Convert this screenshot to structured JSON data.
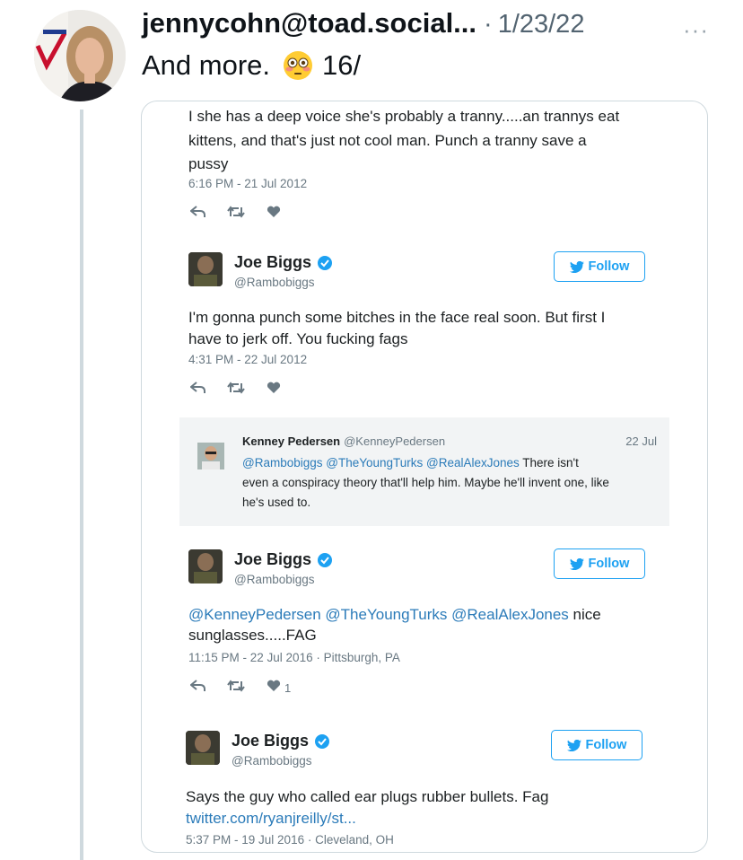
{
  "post": {
    "author": "jennycohn@toad.social...",
    "separator": "·",
    "date": "1/23/22",
    "more_label": "···",
    "text": "And more.",
    "emoji": "flushed-face-emoji",
    "suffix": "16/"
  },
  "embed": {
    "tweet1": {
      "lines": [
        "I she has a deep voice she's probably a tranny.....an trannys eat",
        "kittens, and that's just not cool man. Punch a tranny save a",
        "pussy"
      ],
      "meta": "6:16 PM - 21 Jul 2012"
    },
    "tweet2": {
      "name": "Joe Biggs",
      "handle": "@Rambobiggs",
      "follow": "Follow",
      "lines": [
        "I'm gonna punch some bitches in the face real soon. But first I",
        "have to jerk off. You fucking fags"
      ],
      "meta": "4:31 PM - 22 Jul 2012"
    },
    "quote": {
      "name": "Kenney Pedersen",
      "handle": "@KenneyPedersen",
      "date": "22 Jul",
      "mentions": "@Rambobiggs @TheYoungTurks @RealAlexJones",
      "text_after": " There isn't",
      "line2": "even a conspiracy theory that'll help him. Maybe he'll invent one, like",
      "line3": "he's used to."
    },
    "tweet3": {
      "name": "Joe Biggs",
      "handle": "@Rambobiggs",
      "follow": "Follow",
      "mentions": "@KenneyPedersen @TheYoungTurks @RealAlexJones",
      "text_after": " nice",
      "line2": "sunglasses.....FAG",
      "meta": "11:15 PM - 22 Jul 2016 · Pittsburgh, PA",
      "like_count": "1"
    },
    "tweet4": {
      "name": "Joe Biggs",
      "handle": "@Rambobiggs",
      "follow": "Follow",
      "line1": "Says the guy who called ear plugs rubber bullets. Fag",
      "link": "twitter.com/ryanjreilly/st...",
      "meta": "5:37 PM - 19 Jul 2016 · Cleveland, OH"
    }
  },
  "colors": {
    "link": "#2b7bb9",
    "follow": "#1da1f2",
    "verified": "#1da1f2",
    "muted": "#697882",
    "quote_bg": "#f2f4f5",
    "thread_line": "#cfd9de"
  }
}
